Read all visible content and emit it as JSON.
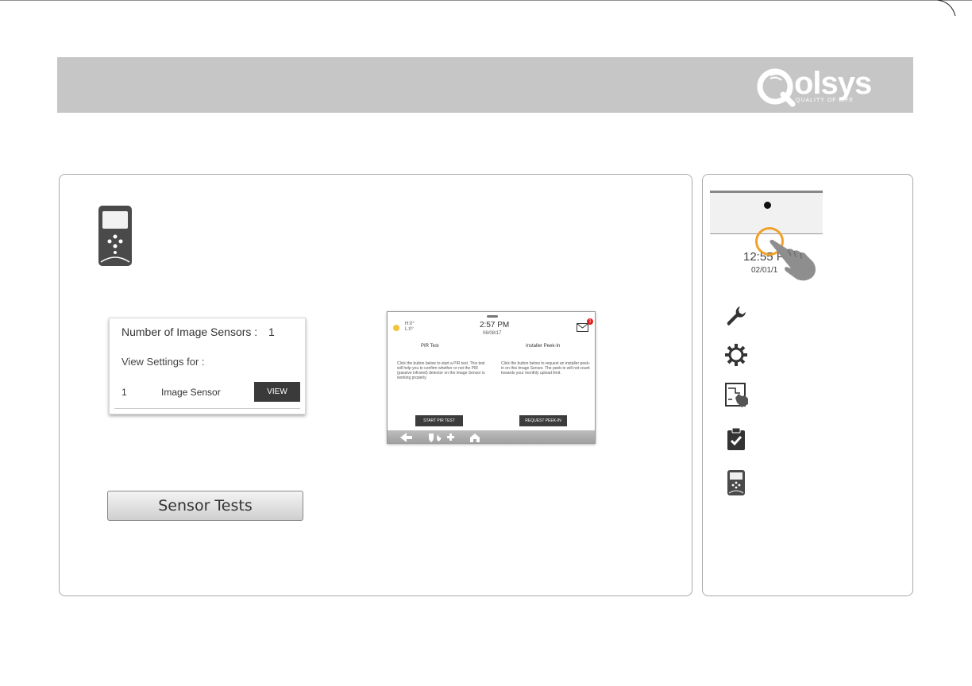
{
  "header": {
    "logo_text": "olsys",
    "logo_tagline": "QUALITY OF LIFE",
    "colors": {
      "band": "#c6c6c6",
      "logo": "#ffffff"
    }
  },
  "main": {
    "device_icon": "image-sensor-icon",
    "settings_card": {
      "count_label": "Number of Image Sensors :",
      "count_value": "1",
      "view_label": "View Settings for :",
      "row": {
        "number": "1",
        "name": "Image Sensor",
        "button": "VIEW"
      }
    },
    "sensor_tests_label": "Sensor Tests",
    "tablet": {
      "weather_hi": "H:0°",
      "weather_lo": "L:0°",
      "time": "2:57 PM",
      "date": "06/08/17",
      "badge": "1",
      "pir_title": "PIR Test",
      "pir_text": "Click the button below to start a PIR test. This test will help you to confirm whether or not the PIR (passive infrared) detector on the image Sensor is working properly.",
      "peek_title": "Installer Peek-In",
      "peek_text": "Click the button below to request an installer peek-in on this Image Sensor. The peek-in will not count towards your monthly upload limit.",
      "pir_button": "START PIR TEST",
      "peek_button": "REQUEST PEEK-IN"
    }
  },
  "side": {
    "time": "12:55 P",
    "date": "02/01/1",
    "icons": [
      "wrench-icon",
      "gear-icon",
      "panel-touch-icon",
      "clipboard-check-icon",
      "image-sensor-icon"
    ],
    "accent": "#f0a12b"
  }
}
